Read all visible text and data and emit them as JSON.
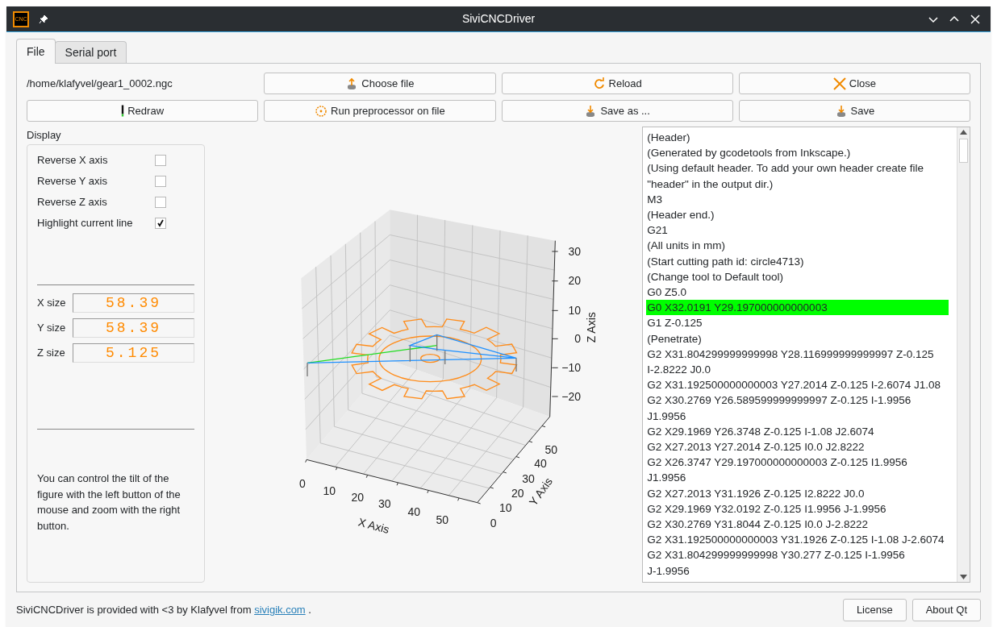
{
  "window": {
    "title": "SiviCNCDriver",
    "app_icon_text": "CNC"
  },
  "tabs": [
    {
      "label": "File",
      "selected": true
    },
    {
      "label": "Serial port",
      "selected": false
    }
  ],
  "file_path": "/home/klafyvel/gear1_0002.ngc",
  "buttons": [
    {
      "label": "Choose file"
    },
    {
      "label": "Reload"
    },
    {
      "label": "Close"
    },
    {
      "label": "Redraw"
    },
    {
      "label": "Run preprocessor on file"
    },
    {
      "label": "Save as ..."
    },
    {
      "label": "Save"
    }
  ],
  "display": {
    "title": "Display",
    "options": [
      {
        "label": "Reverse X axis",
        "checked": false
      },
      {
        "label": "Reverse Y axis",
        "checked": false
      },
      {
        "label": "Reverse Z axis",
        "checked": false
      },
      {
        "label": "Highlight current line",
        "checked": true
      }
    ],
    "sizes": [
      {
        "label": "X size",
        "value": "58.39"
      },
      {
        "label": "Y size",
        "value": "58.39"
      },
      {
        "label": "Z size",
        "value": "5.125"
      }
    ],
    "help": "You can control the tilt of the figure with the left button of the mouse and zoom with the right button."
  },
  "plot": {
    "x_label": "X Axis",
    "y_label": "Y Axis",
    "z_label": "Z Axis",
    "x_ticks": [
      "0",
      "10",
      "20",
      "30",
      "40",
      "50"
    ],
    "y_ticks": [
      "0",
      "10",
      "20",
      "30",
      "40",
      "50"
    ],
    "z_ticks": [
      "30",
      "20",
      "10",
      "0",
      "−10",
      "−20"
    ]
  },
  "gcode": [
    {
      "text": "(Header)",
      "highlighted": false
    },
    {
      "text": "(Generated by gcodetools from Inkscape.)",
      "highlighted": false
    },
    {
      "text": "(Using default header. To add your own header create file \"header\" in the output dir.)",
      "highlighted": false
    },
    {
      "text": "M3",
      "highlighted": false
    },
    {
      "text": "(Header end.)",
      "highlighted": false
    },
    {
      "text": "G21",
      "highlighted": false
    },
    {
      "text": "(All units in mm)",
      "highlighted": false
    },
    {
      "text": "(Start cutting path id: circle4713)",
      "highlighted": false
    },
    {
      "text": "(Change tool to Default tool)",
      "highlighted": false
    },
    {
      "text": "G0 Z5.0",
      "highlighted": false
    },
    {
      "text": "G0 X32.0191 Y29.197000000000003",
      "highlighted": true
    },
    {
      "text": "G1 Z-0.125",
      "highlighted": false
    },
    {
      "text": "(Penetrate)",
      "highlighted": false
    },
    {
      "text": "G2 X31.804299999999998 Y28.116999999999997 Z-0.125 I-2.8222 J0.0",
      "highlighted": false
    },
    {
      "text": "G2 X31.192500000000003 Y27.2014 Z-0.125 I-2.6074 J1.08",
      "highlighted": false
    },
    {
      "text": "G2 X30.2769 Y26.589599999999997 Z-0.125 I-1.9956 J1.9956",
      "highlighted": false
    },
    {
      "text": "G2 X29.1969 Y26.3748 Z-0.125 I-1.08 J2.6074",
      "highlighted": false
    },
    {
      "text": "G2 X27.2013 Y27.2014 Z-0.125 I0.0 J2.8222",
      "highlighted": false
    },
    {
      "text": "G2 X26.3747 Y29.197000000000003 Z-0.125 I1.9956 J1.9956",
      "highlighted": false
    },
    {
      "text": "G2 X27.2013 Y31.1926 Z-0.125 I2.8222 J0.0",
      "highlighted": false
    },
    {
      "text": "G2 X29.1969 Y32.0192 Z-0.125 I1.9956 J-1.9956",
      "highlighted": false
    },
    {
      "text": "G2 X30.2769 Y31.8044 Z-0.125 I0.0 J-2.8222",
      "highlighted": false
    },
    {
      "text": "G2 X31.192500000000003 Y31.1926 Z-0.125 I-1.08 J-2.6074",
      "highlighted": false
    },
    {
      "text": "G2 X31.804299999999998 Y30.277 Z-0.125 I-1.9956 J-1.9956",
      "highlighted": false
    }
  ],
  "footer": {
    "text_before": "SiviCNCDriver is provided with <3 by Klafyvel from",
    "link": "sivigik.com",
    "text_after": ".",
    "buttons": [
      "License",
      "About Qt"
    ]
  }
}
